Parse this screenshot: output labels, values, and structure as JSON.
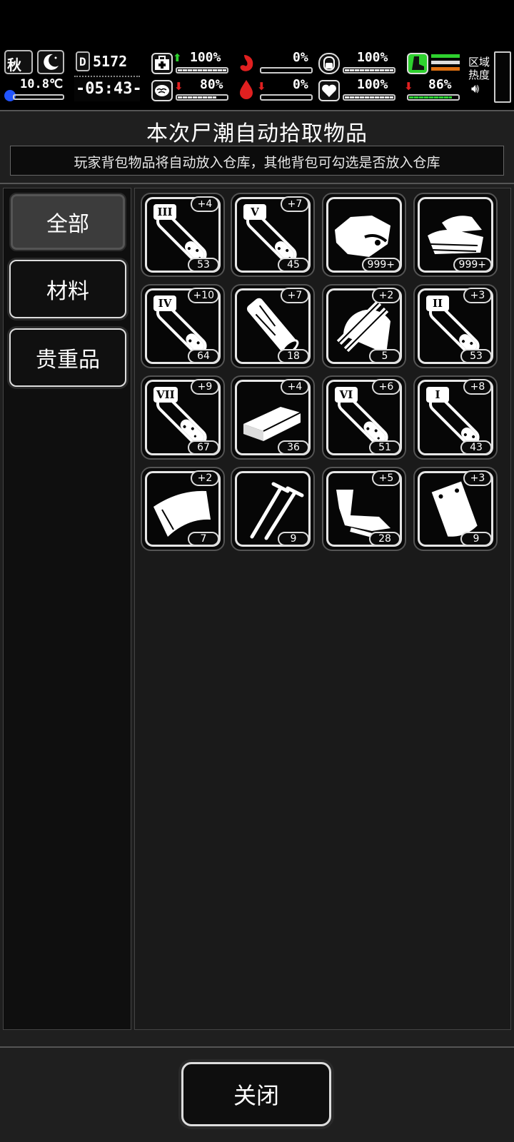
{
  "hud": {
    "season": "秋",
    "temperature": "10.8℃",
    "day": "5172",
    "time": "-05:43-",
    "stats": {
      "health": {
        "value": "100%",
        "trend": "up",
        "level": 1.0
      },
      "stomach": {
        "value": "0%",
        "trend": "none",
        "level": 0.0
      },
      "stamina": {
        "value": "100%",
        "trend": "none",
        "level": 1.0
      },
      "brain": {
        "value": "80%",
        "trend": "down",
        "level": 0.8
      },
      "thirst": {
        "value": "0%",
        "trend": "down",
        "level": 0.0
      },
      "heart": {
        "value": "100%",
        "trend": "none",
        "level": 1.0
      },
      "boot": {
        "value": "86%",
        "trend": "down",
        "level": 0.86
      }
    },
    "area_heat_label": "区域热度",
    "colors": {
      "up": "#2ed12e",
      "down": "#e02020",
      "boot": "#2ed12e"
    }
  },
  "panel": {
    "title": "本次尸潮自动拾取物品",
    "subtitle": "玩家背包物品将自动放入仓库，其他背包可勾选是否放入仓库"
  },
  "categories": [
    {
      "label": "全部",
      "active": true
    },
    {
      "label": "材料",
      "active": false
    },
    {
      "label": "贵重品",
      "active": false
    }
  ],
  "items": [
    {
      "icon": "test-tube-icon",
      "roman": "III",
      "plus": "+4",
      "qty": "53",
      "fill": 0.5
    },
    {
      "icon": "test-tube-icon",
      "roman": "V",
      "plus": "+7",
      "qty": "45",
      "fill": 0.5
    },
    {
      "icon": "meat-icon",
      "roman": "",
      "plus": "",
      "qty": "999+"
    },
    {
      "icon": "cloth-icon",
      "roman": "",
      "plus": "",
      "qty": "999+"
    },
    {
      "icon": "test-tube-icon",
      "roman": "IV",
      "plus": "+10",
      "qty": "64",
      "fill": 0.45
    },
    {
      "icon": "wood-log-icon",
      "roman": "",
      "plus": "+7",
      "qty": "18"
    },
    {
      "icon": "planks-icon",
      "roman": "",
      "plus": "+2",
      "qty": "5"
    },
    {
      "icon": "test-tube-icon",
      "roman": "II",
      "plus": "+3",
      "qty": "53",
      "fill": 0.4
    },
    {
      "icon": "test-tube-icon",
      "roman": "VII",
      "plus": "+9",
      "qty": "67",
      "fill": 0.75
    },
    {
      "icon": "brick-icon",
      "roman": "",
      "plus": "+4",
      "qty": "36"
    },
    {
      "icon": "test-tube-icon",
      "roman": "VI",
      "plus": "+6",
      "qty": "51",
      "fill": 0.65
    },
    {
      "icon": "test-tube-icon",
      "roman": "I",
      "plus": "+8",
      "qty": "43",
      "fill": 0.3
    },
    {
      "icon": "tarp-icon",
      "roman": "",
      "plus": "+2",
      "qty": "7"
    },
    {
      "icon": "nails-icon",
      "roman": "",
      "plus": "",
      "qty": "9"
    },
    {
      "icon": "scrap-metal-icon",
      "roman": "",
      "plus": "+5",
      "qty": "28"
    },
    {
      "icon": "plastic-bag-icon",
      "roman": "",
      "plus": "+3",
      "qty": "9"
    }
  ],
  "footer": {
    "close_label": "关闭"
  }
}
